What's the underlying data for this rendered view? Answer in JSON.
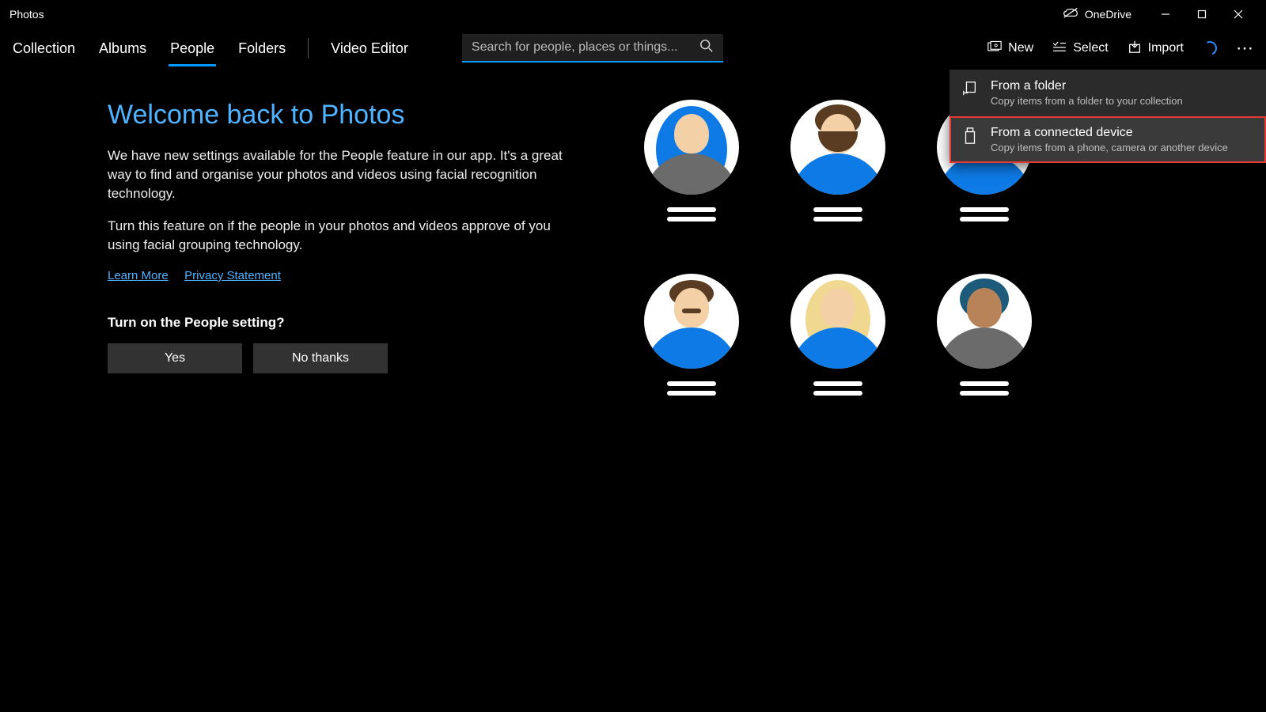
{
  "app": {
    "title": "Photos"
  },
  "titlebar": {
    "onedrive_label": "OneDrive"
  },
  "nav": {
    "tabs": [
      {
        "label": "Collection"
      },
      {
        "label": "Albums"
      },
      {
        "label": "People"
      },
      {
        "label": "Folders"
      }
    ],
    "video_editor_label": "Video Editor"
  },
  "search": {
    "placeholder": "Search for people, places or things..."
  },
  "actions": {
    "new_label": "New",
    "select_label": "Select",
    "import_label": "Import"
  },
  "welcome": {
    "title": "Welcome back to Photos",
    "para1": "We have new settings available for the People feature in our app. It's a great way to find and organise your photos and videos using facial recognition technology.",
    "para2": "Turn this feature on if the people in your photos and videos approve of you using facial grouping technology.",
    "learn_more": "Learn More",
    "privacy": "Privacy Statement",
    "prompt": "Turn on the People setting?",
    "yes": "Yes",
    "no": "No thanks"
  },
  "import_menu": {
    "items": [
      {
        "title": "From a folder",
        "desc": "Copy items from a folder to your collection",
        "highlighted": false
      },
      {
        "title": "From a connected device",
        "desc": "Copy items from a phone, camera or another device",
        "highlighted": true
      }
    ]
  }
}
